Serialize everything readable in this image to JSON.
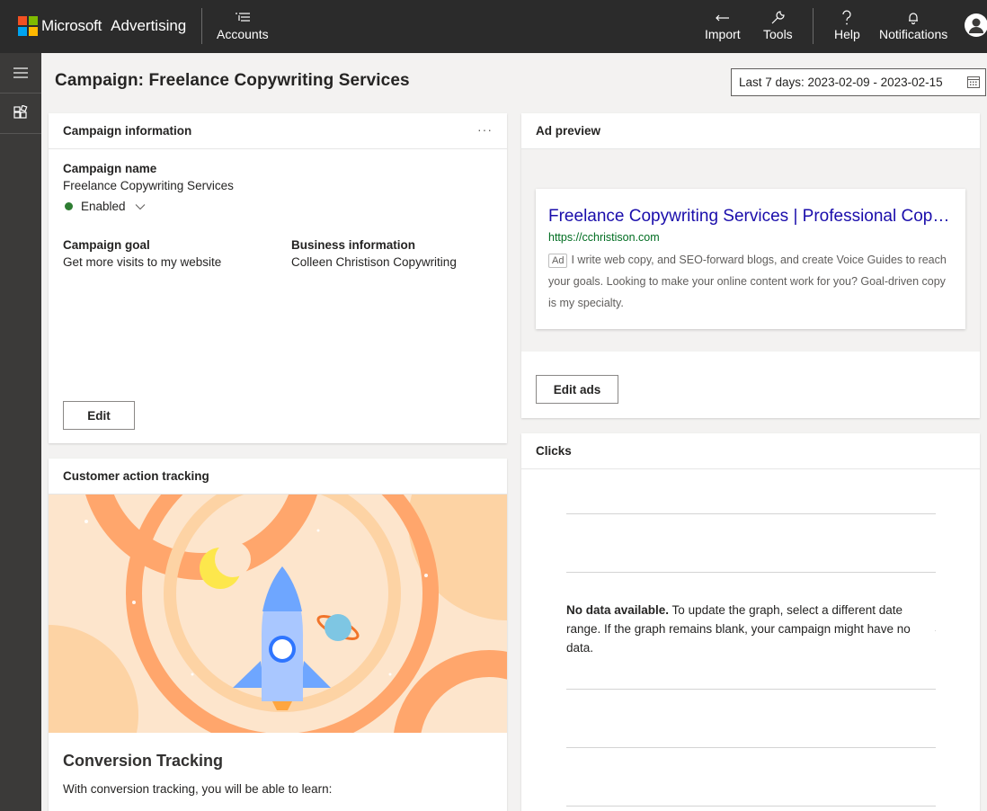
{
  "brand": {
    "name": "Microsoft",
    "product": "Advertising",
    "logo_colors": [
      "#f25022",
      "#7fba00",
      "#00a4ef",
      "#ffb900"
    ]
  },
  "topnav": {
    "accounts": "Accounts",
    "import": "Import",
    "tools": "Tools",
    "help": "Help",
    "notifications": "Notifications"
  },
  "page": {
    "title": "Campaign: Freelance Copywriting Services",
    "date_range": "Last 7 days: 2023-02-09 - 2023-02-15"
  },
  "campaign_info": {
    "header": "Campaign information",
    "more": "···",
    "name_label": "Campaign name",
    "name_value": "Freelance Copywriting Services",
    "status": "Enabled",
    "goal_label": "Campaign goal",
    "goal_value": "Get more visits to my website",
    "business_label": "Business information",
    "business_value": "Colleen Christison Copywriting",
    "edit_button": "Edit"
  },
  "ad_preview": {
    "header": "Ad preview",
    "title": "Freelance Copywriting Services | Professional Copywriting",
    "url": "https://cchristison.com",
    "badge": "Ad",
    "description": "I write web copy, and SEO-forward blogs, and create Voice Guides to reach your goals. Looking to make your online content work for you? Goal-driven copy is my specialty.",
    "edit_button": "Edit ads"
  },
  "clicks": {
    "header": "Clicks",
    "no_data_bold": "No data available.",
    "no_data_text": " To update the graph, select a different date range. If the graph remains blank, your campaign might have no data."
  },
  "conversion": {
    "header": "Customer action tracking",
    "title": "Conversion Tracking",
    "text": "With conversion tracking, you will be able to learn:"
  },
  "colors": {
    "topbar": "#2b2b2b",
    "rail": "#3b3a39",
    "enabled": "#2e7d32",
    "ad_link": "#1a0dab",
    "ad_url": "#006d21"
  }
}
